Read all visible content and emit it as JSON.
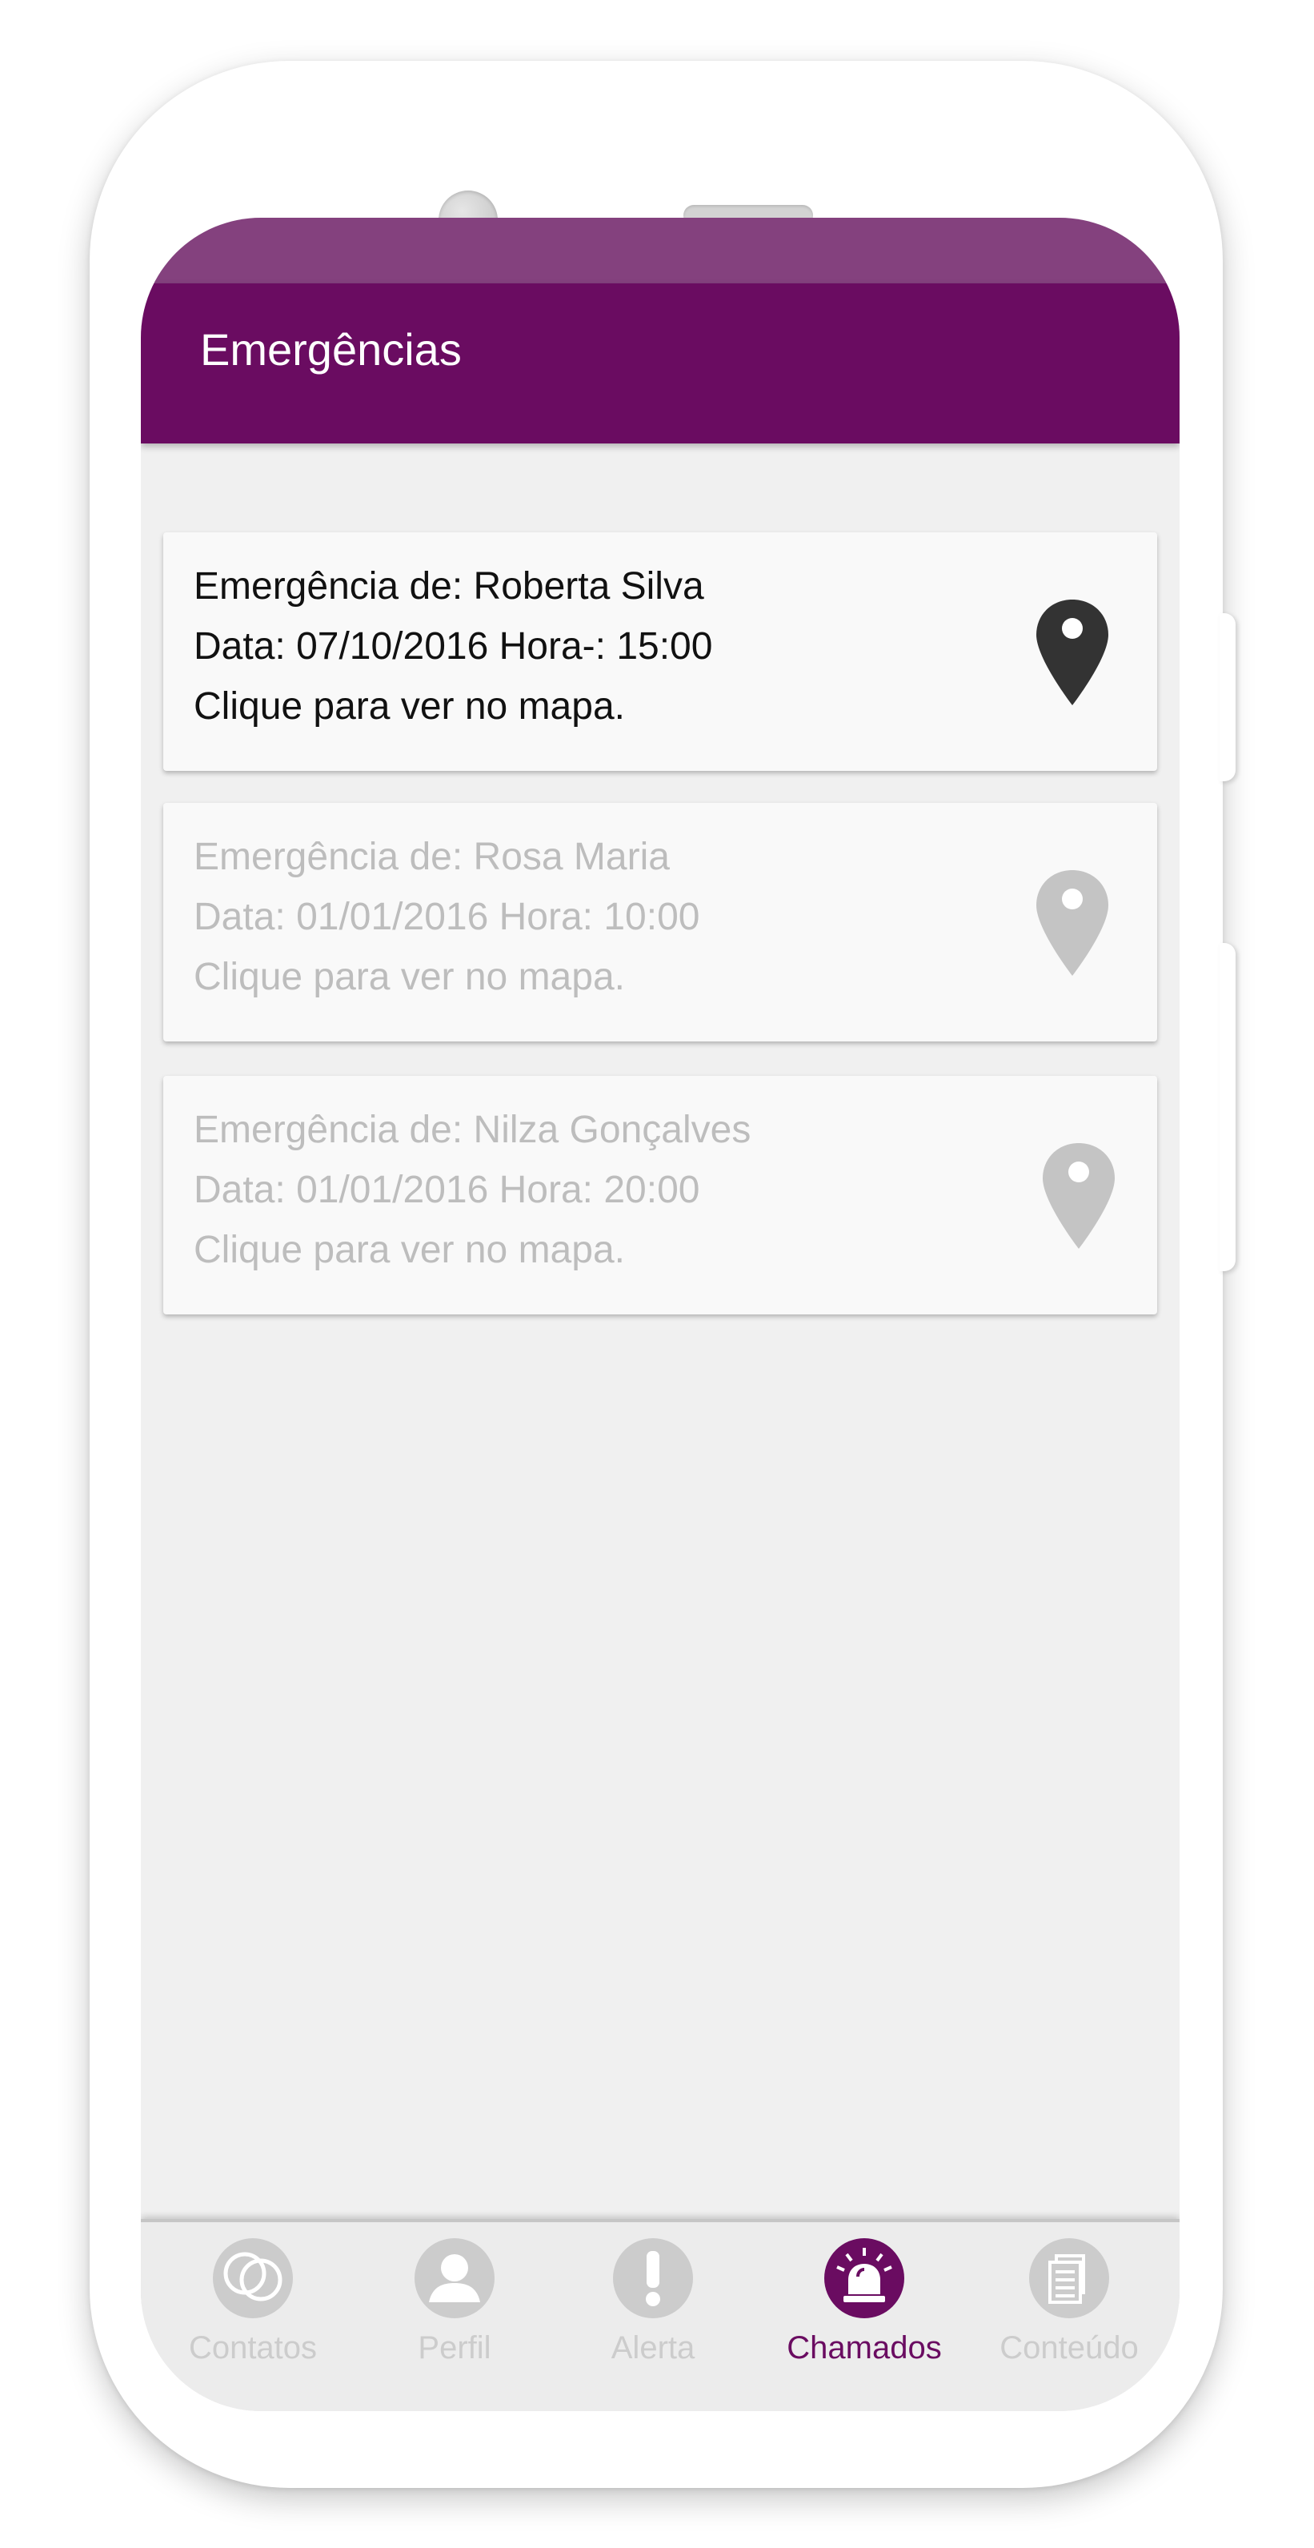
{
  "app_bar": {
    "title": "Emergências"
  },
  "emergencies": [
    {
      "name_line": "Emergência de: Roberta Silva",
      "datetime_line": "Data: 07/10/2016 Hora-: 15:00",
      "hint": "Clique para ver no mapa.",
      "state": "active"
    },
    {
      "name_line": "Emergência de: Rosa Maria",
      "datetime_line": "Data: 01/01/2016 Hora: 10:00",
      "hint": "Clique para ver no mapa.",
      "state": "inactive"
    },
    {
      "name_line": "Emergência de: Nilza Gonçalves",
      "datetime_line": "Data: 01/01/2016 Hora: 20:00",
      "hint": "Clique para ver no mapa.",
      "state": "inactive"
    }
  ],
  "bottom_nav": {
    "items": [
      {
        "label": "Contatos",
        "icon": "contacts-icon"
      },
      {
        "label": "Perfil",
        "icon": "profile-icon"
      },
      {
        "label": "Alerta",
        "icon": "alert-icon"
      },
      {
        "label": "Chamados",
        "icon": "siren-icon",
        "active": true
      },
      {
        "label": "Conteúdo",
        "icon": "content-icon"
      }
    ]
  },
  "colors": {
    "primary": "#6a0c61",
    "status_bar": "#84417e",
    "background": "#f0f0f0",
    "card": "#f9f9f9",
    "pin_active": "#333333",
    "pin_inactive": "#c4c4c4",
    "nav_inactive": "#cccccc"
  }
}
